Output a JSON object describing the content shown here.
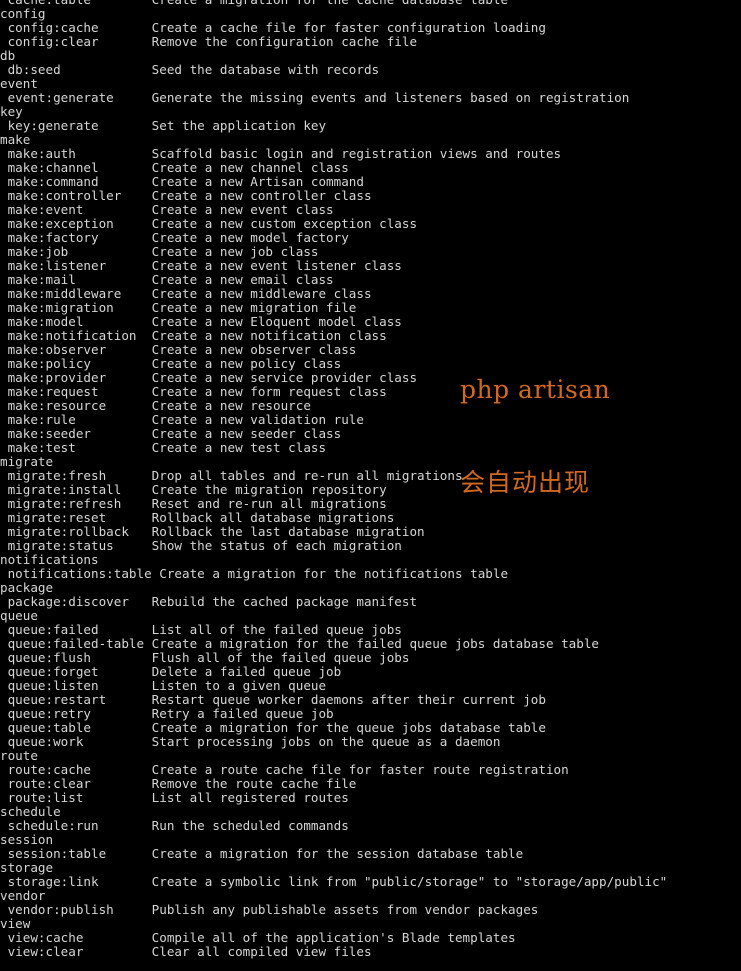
{
  "terminal": {
    "background_color": "#000000",
    "text_color": "#d6d6d6",
    "annotation_color": "#d2691e",
    "description_column": 20
  },
  "annotation": {
    "line1": "php artisan",
    "line2": "会自动出现"
  },
  "console": {
    "lines": [
      {
        "type": "command",
        "name": "cache:table",
        "description": "Create a migration for the cache database table"
      },
      {
        "type": "group",
        "name": "config",
        "description": ""
      },
      {
        "type": "command",
        "name": "config:cache",
        "description": "Create a cache file for faster configuration loading"
      },
      {
        "type": "command",
        "name": "config:clear",
        "description": "Remove the configuration cache file"
      },
      {
        "type": "group",
        "name": "db",
        "description": ""
      },
      {
        "type": "command",
        "name": "db:seed",
        "description": "Seed the database with records"
      },
      {
        "type": "group",
        "name": "event",
        "description": ""
      },
      {
        "type": "command",
        "name": "event:generate",
        "description": "Generate the missing events and listeners based on registration"
      },
      {
        "type": "group",
        "name": "key",
        "description": ""
      },
      {
        "type": "command",
        "name": "key:generate",
        "description": "Set the application key"
      },
      {
        "type": "group",
        "name": "make",
        "description": ""
      },
      {
        "type": "command",
        "name": "make:auth",
        "description": "Scaffold basic login and registration views and routes"
      },
      {
        "type": "command",
        "name": "make:channel",
        "description": "Create a new channel class"
      },
      {
        "type": "command",
        "name": "make:command",
        "description": "Create a new Artisan command"
      },
      {
        "type": "command",
        "name": "make:controller",
        "description": "Create a new controller class"
      },
      {
        "type": "command",
        "name": "make:event",
        "description": "Create a new event class"
      },
      {
        "type": "command",
        "name": "make:exception",
        "description": "Create a new custom exception class"
      },
      {
        "type": "command",
        "name": "make:factory",
        "description": "Create a new model factory"
      },
      {
        "type": "command",
        "name": "make:job",
        "description": "Create a new job class"
      },
      {
        "type": "command",
        "name": "make:listener",
        "description": "Create a new event listener class"
      },
      {
        "type": "command",
        "name": "make:mail",
        "description": "Create a new email class"
      },
      {
        "type": "command",
        "name": "make:middleware",
        "description": "Create a new middleware class"
      },
      {
        "type": "command",
        "name": "make:migration",
        "description": "Create a new migration file"
      },
      {
        "type": "command",
        "name": "make:model",
        "description": "Create a new Eloquent model class"
      },
      {
        "type": "command",
        "name": "make:notification",
        "description": "Create a new notification class"
      },
      {
        "type": "command",
        "name": "make:observer",
        "description": "Create a new observer class"
      },
      {
        "type": "command",
        "name": "make:policy",
        "description": "Create a new policy class"
      },
      {
        "type": "command",
        "name": "make:provider",
        "description": "Create a new service provider class"
      },
      {
        "type": "command",
        "name": "make:request",
        "description": "Create a new form request class"
      },
      {
        "type": "command",
        "name": "make:resource",
        "description": "Create a new resource"
      },
      {
        "type": "command",
        "name": "make:rule",
        "description": "Create a new validation rule"
      },
      {
        "type": "command",
        "name": "make:seeder",
        "description": "Create a new seeder class"
      },
      {
        "type": "command",
        "name": "make:test",
        "description": "Create a new test class"
      },
      {
        "type": "group",
        "name": "migrate",
        "description": ""
      },
      {
        "type": "command",
        "name": "migrate:fresh",
        "description": "Drop all tables and re-run all migrations"
      },
      {
        "type": "command",
        "name": "migrate:install",
        "description": "Create the migration repository"
      },
      {
        "type": "command",
        "name": "migrate:refresh",
        "description": "Reset and re-run all migrations"
      },
      {
        "type": "command",
        "name": "migrate:reset",
        "description": "Rollback all database migrations"
      },
      {
        "type": "command",
        "name": "migrate:rollback",
        "description": "Rollback the last database migration"
      },
      {
        "type": "command",
        "name": "migrate:status",
        "description": "Show the status of each migration"
      },
      {
        "type": "group",
        "name": "notifications",
        "description": ""
      },
      {
        "type": "command",
        "name": "notifications:table",
        "description": "Create a migration for the notifications table"
      },
      {
        "type": "group",
        "name": "package",
        "description": ""
      },
      {
        "type": "command",
        "name": "package:discover",
        "description": "Rebuild the cached package manifest"
      },
      {
        "type": "group",
        "name": "queue",
        "description": ""
      },
      {
        "type": "command",
        "name": "queue:failed",
        "description": "List all of the failed queue jobs"
      },
      {
        "type": "command",
        "name": "queue:failed-table",
        "description": "Create a migration for the failed queue jobs database table"
      },
      {
        "type": "command",
        "name": "queue:flush",
        "description": "Flush all of the failed queue jobs"
      },
      {
        "type": "command",
        "name": "queue:forget",
        "description": "Delete a failed queue job"
      },
      {
        "type": "command",
        "name": "queue:listen",
        "description": "Listen to a given queue"
      },
      {
        "type": "command",
        "name": "queue:restart",
        "description": "Restart queue worker daemons after their current job"
      },
      {
        "type": "command",
        "name": "queue:retry",
        "description": "Retry a failed queue job"
      },
      {
        "type": "command",
        "name": "queue:table",
        "description": "Create a migration for the queue jobs database table"
      },
      {
        "type": "command",
        "name": "queue:work",
        "description": "Start processing jobs on the queue as a daemon"
      },
      {
        "type": "group",
        "name": "route",
        "description": ""
      },
      {
        "type": "command",
        "name": "route:cache",
        "description": "Create a route cache file for faster route registration"
      },
      {
        "type": "command",
        "name": "route:clear",
        "description": "Remove the route cache file"
      },
      {
        "type": "command",
        "name": "route:list",
        "description": "List all registered routes"
      },
      {
        "type": "group",
        "name": "schedule",
        "description": ""
      },
      {
        "type": "command",
        "name": "schedule:run",
        "description": "Run the scheduled commands"
      },
      {
        "type": "group",
        "name": "session",
        "description": ""
      },
      {
        "type": "command",
        "name": "session:table",
        "description": "Create a migration for the session database table"
      },
      {
        "type": "group",
        "name": "storage",
        "description": ""
      },
      {
        "type": "command",
        "name": "storage:link",
        "description": "Create a symbolic link from \"public/storage\" to \"storage/app/public\""
      },
      {
        "type": "group",
        "name": "vendor",
        "description": ""
      },
      {
        "type": "command",
        "name": "vendor:publish",
        "description": "Publish any publishable assets from vendor packages"
      },
      {
        "type": "group",
        "name": "view",
        "description": ""
      },
      {
        "type": "command",
        "name": "view:cache",
        "description": "Compile all of the application's Blade templates"
      },
      {
        "type": "command",
        "name": "view:clear",
        "description": "Clear all compiled view files"
      }
    ]
  }
}
